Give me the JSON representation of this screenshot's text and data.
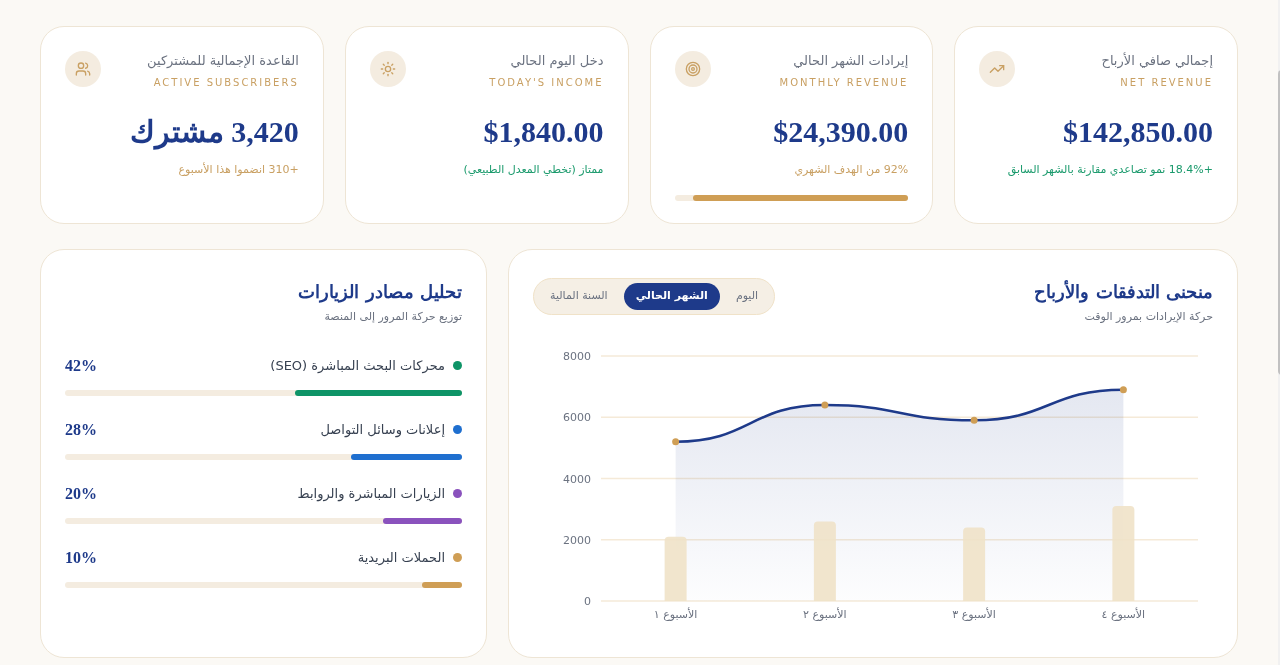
{
  "stat_cards": [
    {
      "title": "إجمالي صافي الأرباح",
      "subtitle": "NET REVENUE",
      "value": "$142,850.00",
      "note": "+18.4% نمو تصاعدي مقارنة بالشهر السابق",
      "positive": true
    },
    {
      "title": "إيرادات الشهر الحالي",
      "subtitle": "MONTHLY REVENUE",
      "value": "$24,390.00",
      "note": "92% من الهدف الشهري",
      "positive": false,
      "level": 0.92
    },
    {
      "title": "دخل اليوم الحالي",
      "subtitle": "TODAY'S INCOME",
      "value": "$1,840.00",
      "note": "ممتاز (تخطي المعدل الطبيعي)",
      "positive": true
    },
    {
      "title": "القاعدة الإجمالية للمشتركين",
      "subtitle": "ACTIVE SUBSCRIBERS",
      "value": "3,420 مشترك",
      "note": "+310 انضموا هذا الأسبوع",
      "positive": false
    }
  ],
  "revenue_chart": {
    "title": "منحنى التدفقات والأرباح",
    "subtitle": "حركة الإيرادات بمرور الوقت",
    "tabs": [
      {
        "label": "اليوم",
        "selected": false
      },
      {
        "label": "الشهر الحالي",
        "selected": true
      },
      {
        "label": "السنة المالية",
        "selected": false
      }
    ],
    "chart_data": {
      "type": "area",
      "grid": true,
      "categories": [
        "الأسبوع ١",
        "الأسبوع ٢",
        "الأسبوع ٣",
        "الأسبوع ٤"
      ],
      "ylim": [
        0,
        8000
      ],
      "yticks": [
        0,
        2000,
        4000,
        6000,
        8000
      ],
      "series": [
        {
          "color": "#1e3a8a",
          "marker": true,
          "values": [
            5200,
            6400,
            5900,
            6900
          ]
        },
        {
          "type": "bar",
          "color": "#f0e2c8",
          "values": [
            2100,
            2600,
            2400,
            3100
          ]
        }
      ]
    }
  },
  "traffic_sources": {
    "title": "تحليل مصادر الزيارات",
    "subtitle": "توزيع حركة المرور إلى المنصة",
    "items": [
      {
        "label": "محركات البحث المباشرة (SEO)",
        "percent": "42%",
        "level": 0.42,
        "color": "#0e9467"
      },
      {
        "label": "إعلانات وسائل التواصل",
        "percent": "28%",
        "level": 0.28,
        "color": "#1f6fcf"
      },
      {
        "label": "الزيارات المباشرة والروابط",
        "percent": "20%",
        "level": 0.2,
        "color": "#8a52bd"
      },
      {
        "label": "الحملات البريدية",
        "percent": "10%",
        "level": 0.1,
        "color": "#cf9e55"
      }
    ]
  }
}
